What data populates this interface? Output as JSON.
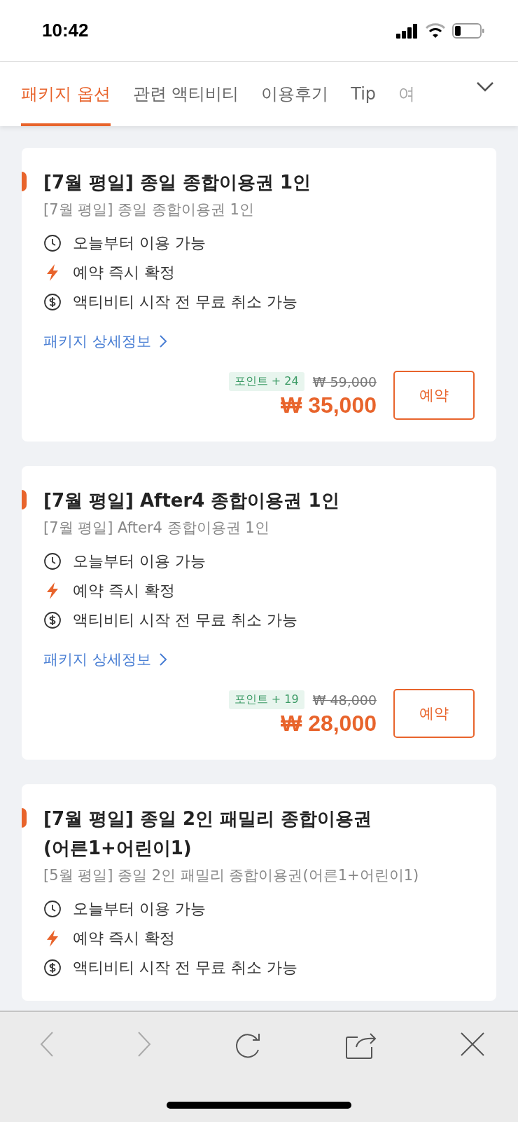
{
  "status_bar": {
    "time": "10:42"
  },
  "tabs": [
    {
      "label": "패키지 옵션",
      "selected": true
    },
    {
      "label": "관련 액티비티",
      "selected": false
    },
    {
      "label": "이용후기",
      "selected": false
    },
    {
      "label": "Tip",
      "selected": false
    },
    {
      "label": "여",
      "selected": false
    }
  ],
  "packages": [
    {
      "title": "[7월 평일] 종일 종합이용권 1인",
      "subtitle": "[7월 평일] 종일 종합이용권 1인",
      "features": [
        {
          "kind": "clock",
          "text": "오늘부터 이용 가능"
        },
        {
          "kind": "bolt",
          "text": "예약 즉시 확정"
        },
        {
          "kind": "dollar",
          "text": "액티비티 시작 전 무료 취소 가능"
        }
      ],
      "detail_link": "패키지 상세정보",
      "points": "포인트 + 24",
      "original_price": "₩ 59,000",
      "price": "₩ 35,000",
      "book_button": "예약"
    },
    {
      "title": "[7월 평일] After4 종합이용권 1인",
      "subtitle": "[7월 평일] After4 종합이용권 1인",
      "features": [
        {
          "kind": "clock",
          "text": "오늘부터 이용 가능"
        },
        {
          "kind": "bolt",
          "text": "예약 즉시 확정"
        },
        {
          "kind": "dollar",
          "text": "액티비티 시작 전 무료 취소 가능"
        }
      ],
      "detail_link": "패키지 상세정보",
      "points": "포인트 + 19",
      "original_price": "₩ 48,000",
      "price": "₩ 28,000",
      "book_button": "예약"
    },
    {
      "title": "[7월 평일] 종일 2인 패밀리 종합이용권(어른1+어린이1)",
      "subtitle": "[5월 평일] 종일 2인 패밀리 종합이용권(어른1+어린이1)",
      "features": [
        {
          "kind": "clock",
          "text": "오늘부터 이용 가능"
        },
        {
          "kind": "bolt",
          "text": "예약 즉시 확정"
        },
        {
          "kind": "dollar",
          "text": "액티비티 시작 전 무료 취소 가능"
        }
      ]
    }
  ],
  "toolbar": [
    {
      "kind": "back",
      "disabled": true
    },
    {
      "kind": "forward",
      "disabled": true
    },
    {
      "kind": "reload",
      "disabled": false
    },
    {
      "kind": "share",
      "disabled": false
    },
    {
      "kind": "close",
      "disabled": false
    }
  ]
}
